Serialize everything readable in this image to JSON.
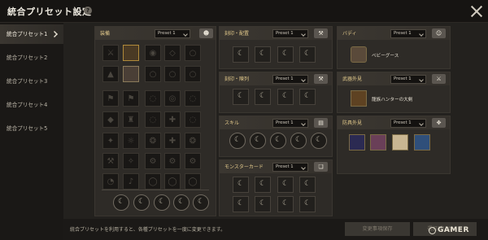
{
  "header": {
    "title": "統合プリセット設定",
    "help": "?"
  },
  "sidebar": {
    "items": [
      {
        "label": "統合プリセット1"
      },
      {
        "label": "統合プリセット2"
      },
      {
        "label": "統合プリセット3"
      },
      {
        "label": "統合プリセット4"
      },
      {
        "label": "統合プリセット5"
      }
    ]
  },
  "panels": {
    "equipment": {
      "title": "装備",
      "preset": "Preset 1"
    },
    "engrave_main": {
      "title": "刻印・配置",
      "preset": "Preset 1"
    },
    "engrave_slot": {
      "title": "刻印・陳列",
      "preset": "Preset 1"
    },
    "skill": {
      "title": "スキル",
      "preset": "Preset 1"
    },
    "monster_card": {
      "title": "モンスターカード",
      "preset": "Preset 1"
    },
    "buddy": {
      "title": "バディ",
      "preset": "Preset 1",
      "item": "ベビーグース"
    },
    "weapon_skin": {
      "title": "武器外見",
      "preset": "Preset 1",
      "item": "龍族ハンターの大剣"
    },
    "armor_skin": {
      "title": "防具外見",
      "preset": "Preset 1"
    }
  },
  "footer": {
    "text": "統合プリセットを利用すると、各種プリセットを一度に変更できます。",
    "save_label": "変更事項保存",
    "select_label": "選択プリセット"
  },
  "watermark": "GAMER"
}
